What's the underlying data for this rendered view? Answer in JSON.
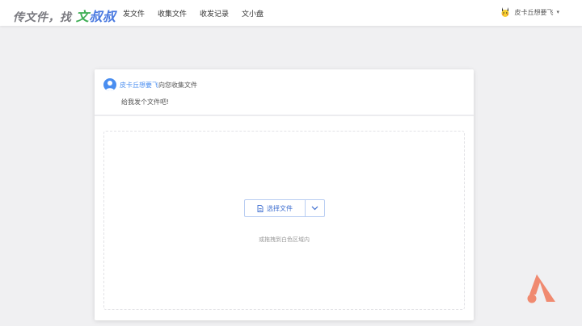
{
  "header": {
    "logo_prefix": "传文件，找",
    "logo_wen": "文",
    "logo_shushu": "叔叔",
    "nav": [
      "发文件",
      "收集文件",
      "收发记录",
      "文小盘"
    ],
    "user_name": "皮卡丘想要飞",
    "caret": "▾"
  },
  "card": {
    "sender_name": "皮卡丘想要飞",
    "sender_suffix": "向您收集文件",
    "message": "给我发个文件吧!",
    "choose_button": "选择文件",
    "hint": "或拖拽到白色区域内"
  },
  "icons": {
    "avatar": "pikachu-avatar-icon",
    "file": "file-icon",
    "chevron": "chevron-down-icon",
    "brand": "brand-logo-icon"
  },
  "colors": {
    "accent": "#4a8ef0",
    "logo_green": "#3fae55",
    "logo_blue": "#4a7ae0",
    "brand_coral": "#f08a70"
  }
}
